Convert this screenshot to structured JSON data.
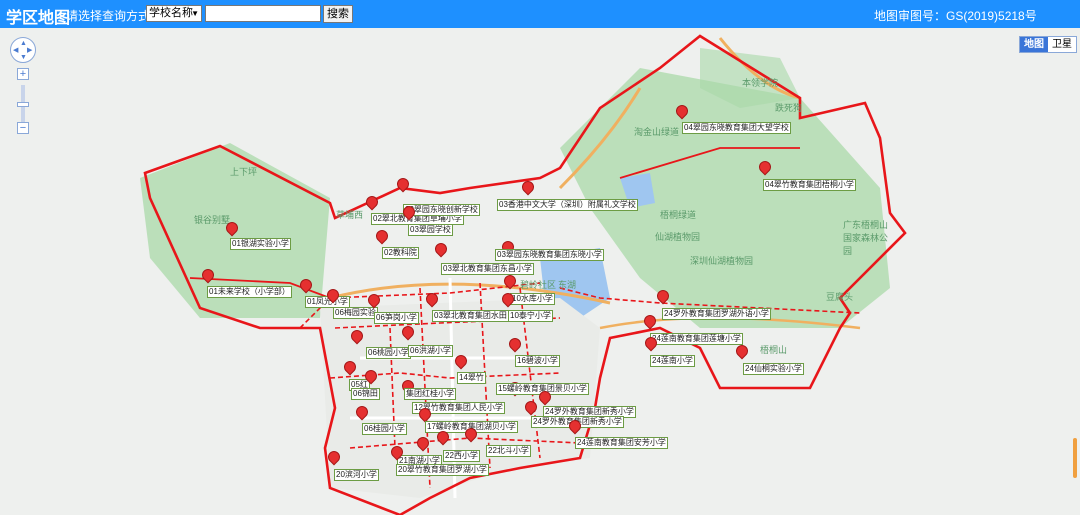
{
  "header": {
    "app_title": "学区地图",
    "query_label": "请选择查询方式:",
    "query_mode": "学校名称",
    "search_placeholder": "",
    "search_button": "搜索",
    "approval_no": "地图审图号：GS(2019)5218号"
  },
  "map_controls": {
    "zoom_in": "+",
    "zoom_out": "−",
    "map_types": [
      "地图",
      "卫星"
    ],
    "active_map_type": "地图"
  },
  "colors": {
    "topbar": "#1e90ff",
    "district_border": "#e8161a",
    "road": "#f0b060",
    "green": "#a9d9a8",
    "water": "#9fc6f0",
    "pin": "#e53030"
  },
  "places": [
    {
      "id": "p1",
      "name": "本领学院"
    },
    {
      "id": "p2",
      "name": "跌死狗"
    },
    {
      "id": "p3",
      "name": "淘金山绿道"
    },
    {
      "id": "p4",
      "name": "梧桐绿道"
    },
    {
      "id": "p5",
      "name": "上下坪"
    },
    {
      "id": "p6",
      "name": "银谷别墅"
    },
    {
      "id": "p7",
      "name": "仙湖植物园"
    },
    {
      "id": "p8",
      "name": "广东梧桐山国家森林公园"
    },
    {
      "id": "p9",
      "name": "深圳仙湖植物园"
    },
    {
      "id": "p10",
      "name": "梧桐山"
    },
    {
      "id": "p11",
      "name": "豆腐头"
    },
    {
      "id": "p12",
      "name": "东湖"
    },
    {
      "id": "p13",
      "name": "碧岭社区"
    },
    {
      "id": "p14",
      "name": "草埔西"
    }
  ],
  "schools": [
    {
      "id": "s1",
      "name": "04翠园东晓教育集团大望学校"
    },
    {
      "id": "s2",
      "name": "04翠竹教育集团梧桐小学"
    },
    {
      "id": "s3",
      "name": "03香港中文大学（深圳）附属礼文学校"
    },
    {
      "id": "s4",
      "name": "01银湖实验小学"
    },
    {
      "id": "s5",
      "name": "01未来学校（小学部）"
    },
    {
      "id": "s6",
      "name": "02翠北教育集团草埔小学"
    },
    {
      "id": "s7",
      "name": "03翠园东晓创新学校"
    },
    {
      "id": "s8",
      "name": "03翠园学校"
    },
    {
      "id": "s9",
      "name": "02教科院"
    },
    {
      "id": "s10",
      "name": "03翠园东晓教育集团东晓小学"
    },
    {
      "id": "s11",
      "name": "03翠北教育集团东昌小学"
    },
    {
      "id": "s12",
      "name": "01凤光小学"
    },
    {
      "id": "s13",
      "name": "06梅园实验"
    },
    {
      "id": "s14",
      "name": "06笋岗小学"
    },
    {
      "id": "s15",
      "name": "03翠北教育集团水田"
    },
    {
      "id": "s16",
      "name": "10水库小学"
    },
    {
      "id": "s17",
      "name": "10泰宁小学"
    },
    {
      "id": "s18",
      "name": "24罗外教育集团罗湖外语小学"
    },
    {
      "id": "s19",
      "name": "24莲南教育集团莲塘小学"
    },
    {
      "id": "s20",
      "name": "24莲南小学"
    },
    {
      "id": "s21",
      "name": "24仙桐实验小学"
    },
    {
      "id": "s22",
      "name": "06桃园小学"
    },
    {
      "id": "s23",
      "name": "06洪湖小学"
    },
    {
      "id": "s24",
      "name": "16碧波小学"
    },
    {
      "id": "s25",
      "name": "14翠竹"
    },
    {
      "id": "s26",
      "name": "05红"
    },
    {
      "id": "s27",
      "name": "06锦田"
    },
    {
      "id": "s28",
      "name": "集团红桂小学"
    },
    {
      "id": "s29",
      "name": "15螺岭教育集团景贝小学"
    },
    {
      "id": "s30",
      "name": "12翠竹教育集团人民小学"
    },
    {
      "id": "s31",
      "name": "24罗外教育集团新秀小学"
    },
    {
      "id": "s32",
      "name": "24罗外教育集团新秀小学"
    },
    {
      "id": "s33",
      "name": "06桂园小学"
    },
    {
      "id": "s34",
      "name": "17螺岭教育集团湖贝小学"
    },
    {
      "id": "s35",
      "name": "24莲南教育集团安芳小学"
    },
    {
      "id": "s36",
      "name": "22北斗小学"
    },
    {
      "id": "s37",
      "name": "22西小学"
    },
    {
      "id": "s38",
      "name": "21南湖小学"
    },
    {
      "id": "s39",
      "name": "20翠竹教育集团罗湖小学"
    },
    {
      "id": "s40",
      "name": "20滨河小学"
    }
  ]
}
